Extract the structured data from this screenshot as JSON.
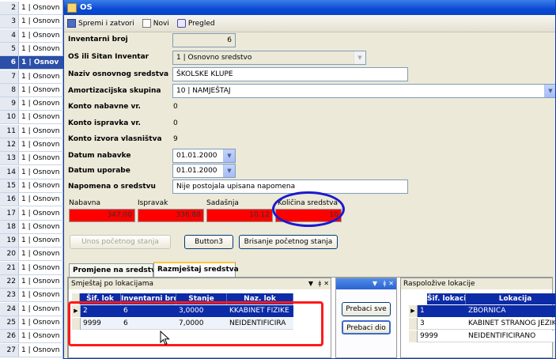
{
  "bg_list": [
    {
      "num": "2",
      "text": "1 | Osnovn"
    },
    {
      "num": "3",
      "text": "1 | Osnovn"
    },
    {
      "num": "4",
      "text": "1 | Osnovn"
    },
    {
      "num": "5",
      "text": "1 | Osnovn"
    },
    {
      "num": "6",
      "text": "1 | Osnov",
      "selected": true
    },
    {
      "num": "7",
      "text": "1 | Osnovn"
    },
    {
      "num": "8",
      "text": "1 | Osnovn"
    },
    {
      "num": "9",
      "text": "1 | Osnovn"
    },
    {
      "num": "10",
      "text": "1 | Osnovn"
    },
    {
      "num": "11",
      "text": "1 | Osnovn"
    },
    {
      "num": "12",
      "text": "1 | Osnovn"
    },
    {
      "num": "13",
      "text": "1 | Osnovn"
    },
    {
      "num": "14",
      "text": "1 | Osnovn"
    },
    {
      "num": "15",
      "text": "1 | Osnovn"
    },
    {
      "num": "16",
      "text": "1 | Osnovn"
    },
    {
      "num": "17",
      "text": "1 | Osnovn"
    },
    {
      "num": "18",
      "text": "1 | Osnovn"
    },
    {
      "num": "19",
      "text": "1 | Osnovn"
    },
    {
      "num": "20",
      "text": "1 | Osnovn"
    },
    {
      "num": "21",
      "text": "1 | Osnovn"
    },
    {
      "num": "22",
      "text": "1 | Osnovn"
    },
    {
      "num": "23",
      "text": "1 | Osnovn"
    },
    {
      "num": "24",
      "text": "1 | Osnovn"
    },
    {
      "num": "25",
      "text": "1 | Osnovn"
    },
    {
      "num": "26",
      "text": "1 | Osnovn"
    },
    {
      "num": "27",
      "text": "1 | Osnovn"
    }
  ],
  "window": {
    "title": "OS"
  },
  "toolbar": {
    "save_close": "Spremi i zatvori",
    "new": "Novi",
    "preview": "Pregled"
  },
  "form": {
    "inventarni_broj": {
      "label": "Inventarni broj",
      "value": "6"
    },
    "os_sitan": {
      "label": "OS ili Sitan Inventar",
      "value": "1 | Osnovno sredstvo"
    },
    "naziv": {
      "label": "Naziv osnovnog sredstva",
      "value": "ŠKOLSKE KLUPE"
    },
    "amortizacija": {
      "label": "Amortizacijska skupina",
      "value": "10 | NAMJEŠTAJ"
    },
    "konto_nabavne": {
      "label": "Konto nabavne vr.",
      "value": "0"
    },
    "konto_ispravka": {
      "label": "Konto ispravka vr.",
      "value": "0"
    },
    "konto_izvora": {
      "label": "Konto izvora vlasništva",
      "value": "9"
    },
    "datum_nabavke": {
      "label": "Datum nabavke",
      "value": "01.01.2000"
    },
    "datum_uporabe": {
      "label": "Datum uporabe",
      "value": "01.01.2000"
    },
    "napomena": {
      "label": "Napomena o sredstvu",
      "value": "Nije postojala upisana napomena"
    }
  },
  "values": {
    "nabavna": {
      "label": "Nabavna",
      "value": "347,00"
    },
    "ispravak": {
      "label": "Ispravak",
      "value": "336,88"
    },
    "sadasnja": {
      "label": "Sadašnja",
      "value": "10,12"
    },
    "kolicina": {
      "label": "Količina sredstva",
      "value": "10"
    }
  },
  "buttons": {
    "unos": "Unos početnog stanja",
    "button3": "Button3",
    "brisanje": "Brisanje početnog stanja"
  },
  "tabs": [
    "Promjene na sredstvu",
    "Razmještaj sredstva"
  ],
  "left_panel": {
    "title": "Smještaj po lokacijama",
    "headers": [
      "Šif. lok",
      "Inventarni broj",
      "Stanje",
      "Naz. lok"
    ],
    "rows": [
      [
        "2",
        "6",
        "3,0000",
        "KKABINET FIZIKE"
      ],
      [
        "9999",
        "6",
        "7,0000",
        "NEIDENTIFICIRA"
      ]
    ]
  },
  "mid_panel": {
    "prebaci_sve": "Prebaci sve",
    "prebaci_dio": "Prebaci dio"
  },
  "right_panel": {
    "title": "Raspoložive lokacije",
    "headers": [
      "Šif. lokacije",
      "Lokacija"
    ],
    "rows": [
      [
        "1",
        "ZBORNICA"
      ],
      [
        "3",
        "KABINET STRANOG JEZIKA"
      ],
      [
        "9999",
        "NEIDENTIFICIRANO"
      ]
    ]
  }
}
